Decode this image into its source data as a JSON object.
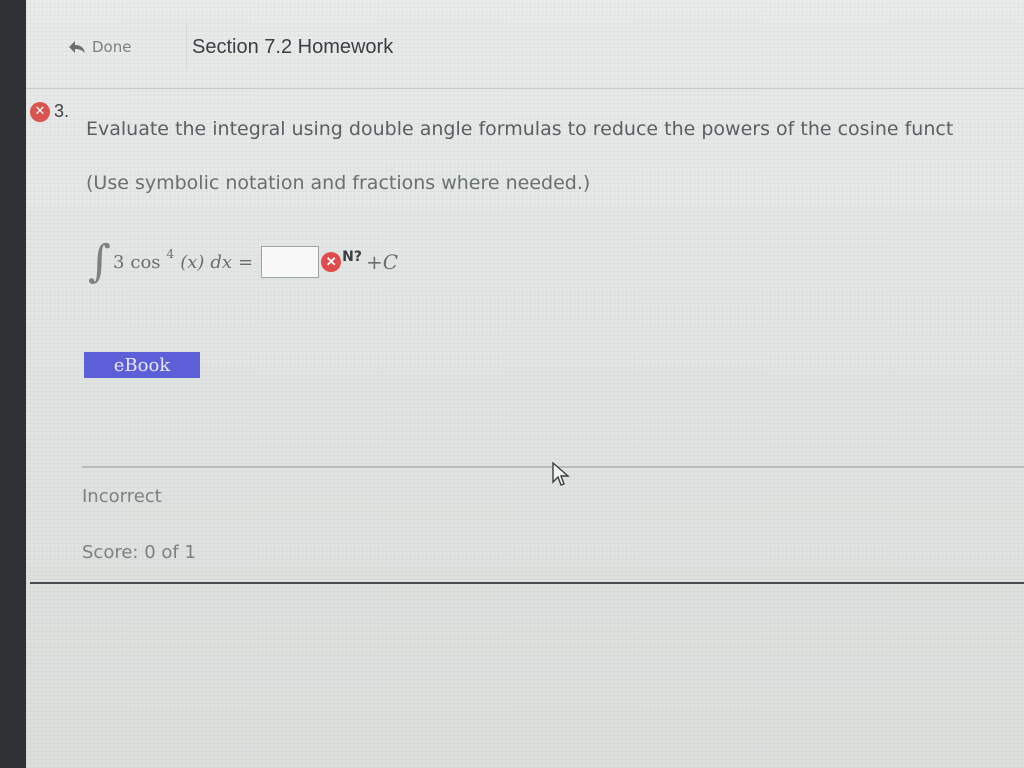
{
  "header": {
    "done_label": "Done",
    "section_title": "Section 7.2 Homework"
  },
  "question": {
    "number": "3.",
    "status_icon": "incorrect-x-icon",
    "prompt": "Evaluate the integral using double angle formulas to reduce the powers of the cosine funct",
    "hint": "(Use symbolic notation and fractions where needed.)",
    "formula": {
      "integral_symbol": "∫",
      "coefficient": "3",
      "func": "cos",
      "power": "4",
      "argument": "(x)",
      "differential": "dx",
      "equals": "=",
      "answer_value": "",
      "answer_icon": "incorrect-x-icon",
      "help_symbol": "N?",
      "constant": "+C"
    }
  },
  "ebook_label": "eBook",
  "result": {
    "status": "Incorrect",
    "score": "Score: 0 of 1"
  },
  "colors": {
    "incorrect": "#e24b4b",
    "ebook": "#5c5fd8",
    "text": "#5a5f63"
  }
}
